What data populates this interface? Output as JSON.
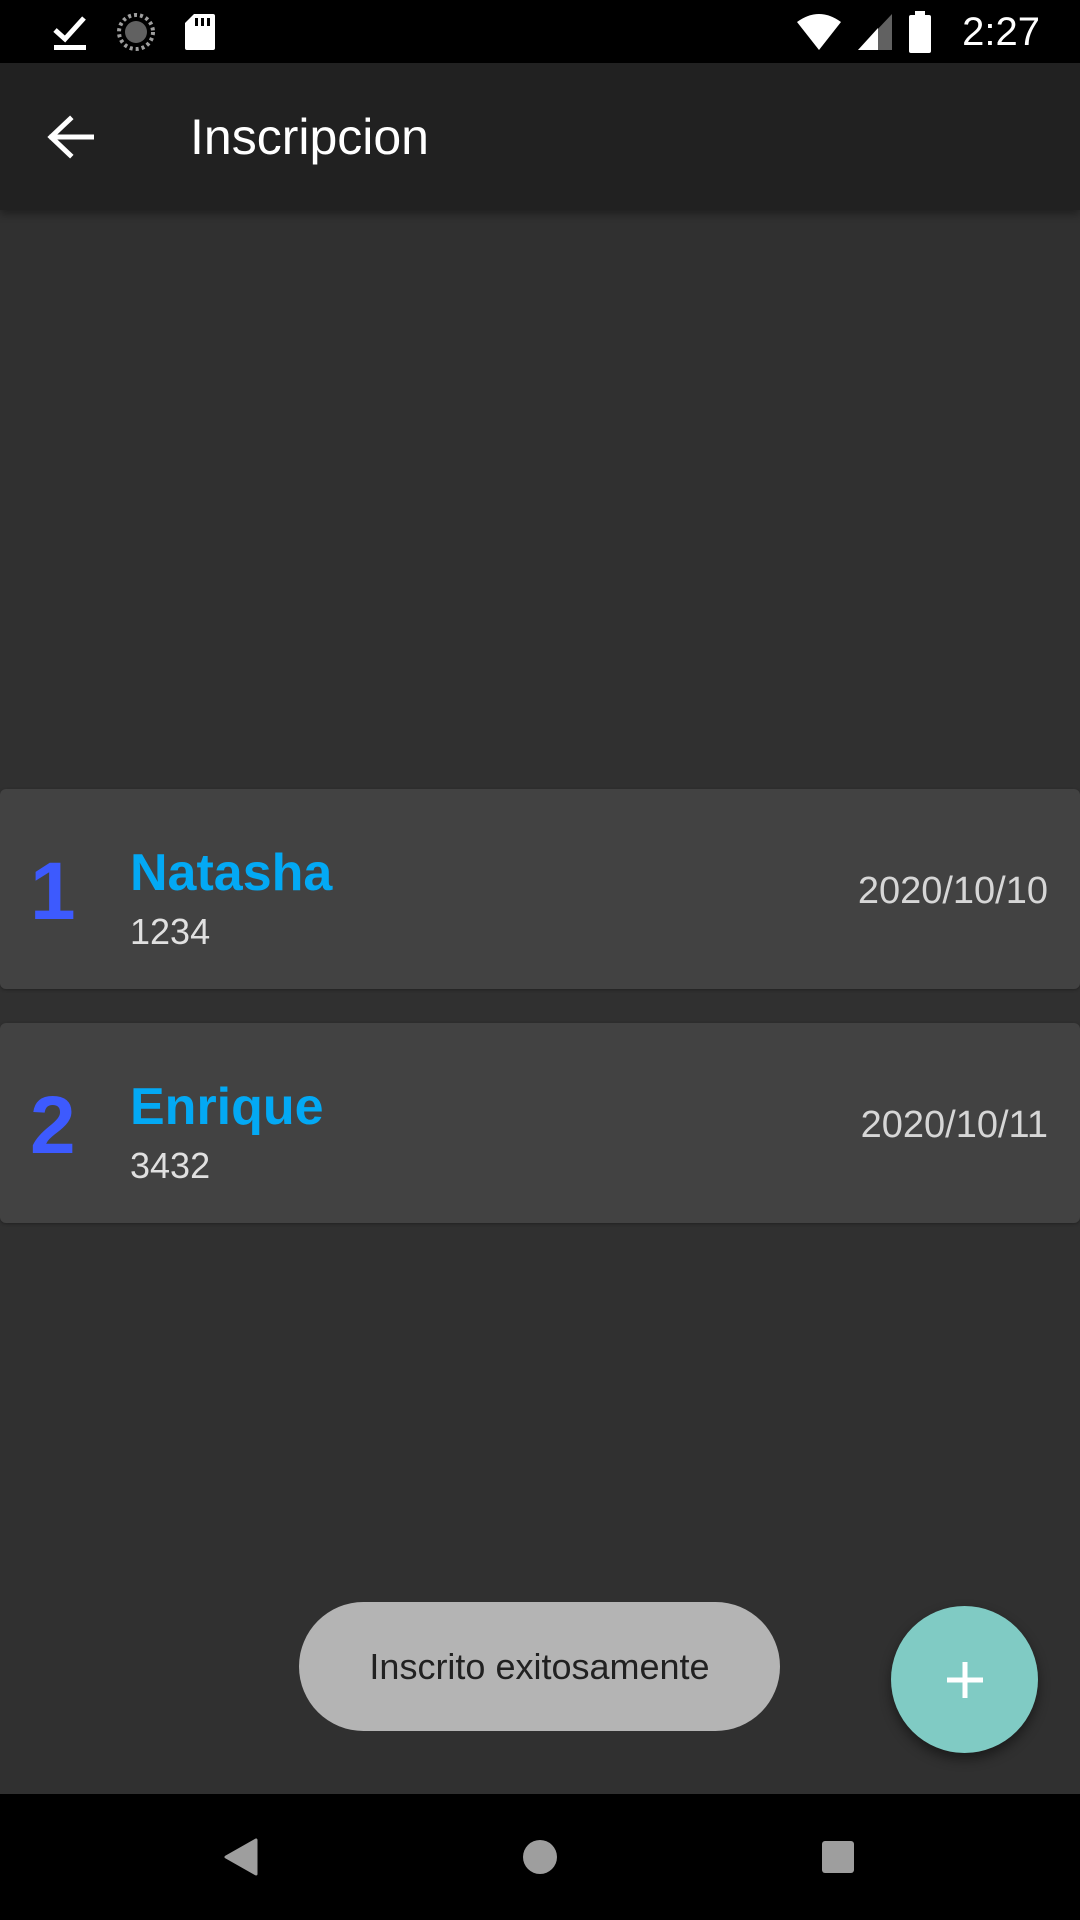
{
  "status_bar": {
    "time": "2:27",
    "icons": [
      "check-icon",
      "sync-progress-icon",
      "sd-card-icon",
      "wifi-icon",
      "cell-signal-icon",
      "battery-icon"
    ]
  },
  "app_bar": {
    "title": "Inscripcion",
    "back_icon": "arrow-back-icon"
  },
  "inscriptions": [
    {
      "number": "1",
      "name": "Natasha",
      "code": "1234",
      "date": "2020/10/10"
    },
    {
      "number": "2",
      "name": "Enrique",
      "code": "3432",
      "date": "2020/10/11"
    }
  ],
  "toast": {
    "message": "Inscrito exitosamente"
  },
  "fab": {
    "icon": "plus-icon"
  },
  "nav_bar": {
    "icons": [
      "back-triangle-icon",
      "home-circle-icon",
      "recents-square-icon"
    ]
  },
  "colors": {
    "background": "#303030",
    "app_bar": "#212121",
    "card": "#424242",
    "number": "#3d5afe",
    "name": "#03a9f4",
    "fab": "#80cbc4",
    "toast": "#b4b4b4"
  }
}
